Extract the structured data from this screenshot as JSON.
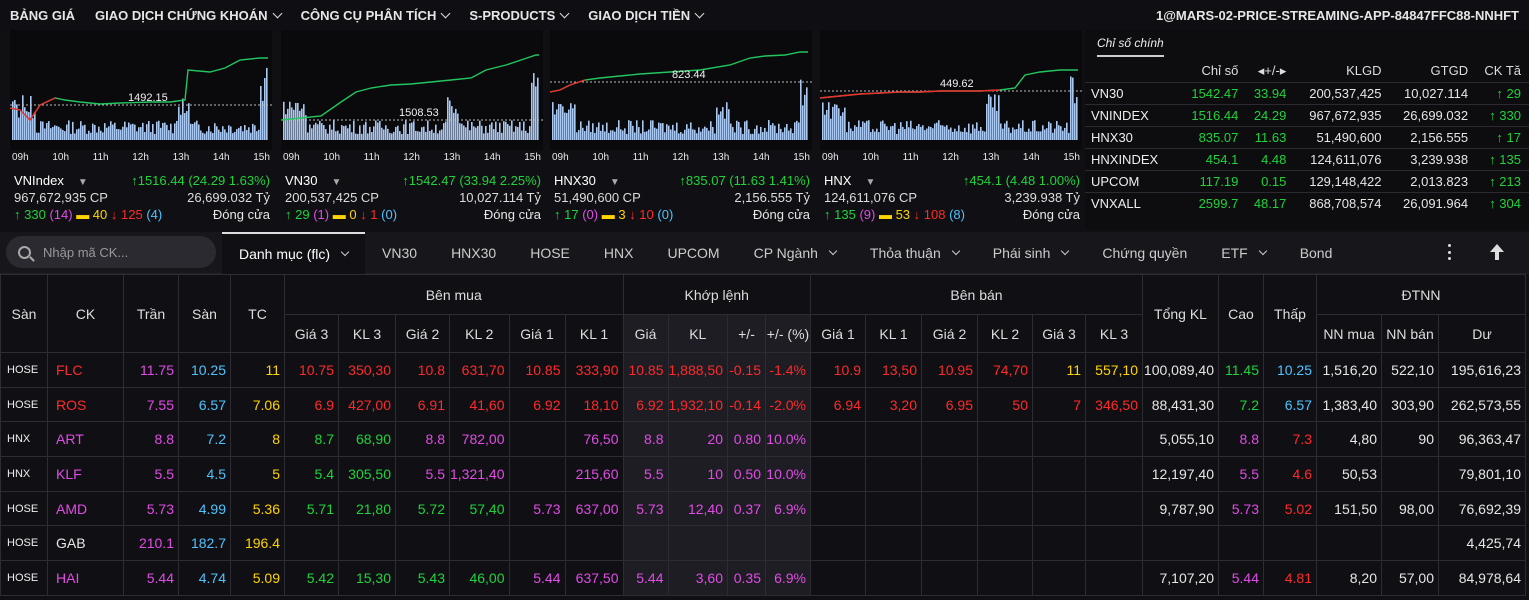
{
  "nav": {
    "items": [
      {
        "label": "BẢNG GIÁ",
        "dropdown": false
      },
      {
        "label": "GIAO DỊCH CHỨNG KHOÁN",
        "dropdown": true
      },
      {
        "label": "CÔNG CỤ PHÂN TÍCH",
        "dropdown": true
      },
      {
        "label": "S-PRODUCTS",
        "dropdown": true
      },
      {
        "label": "GIAO DỊCH TIỀN",
        "dropdown": true
      }
    ],
    "app_id": "1@MARS-02-PRICE-STREAMING-APP-84847FFC88-NNHFT"
  },
  "charts": [
    {
      "name": "VNIndex",
      "change": "↑1516.44 (24.29  1.63%)",
      "volume": "967,672,935 CP",
      "value": "26,699.032 Tỷ",
      "breadth": {
        "up": "↑ 330",
        "ceil": "(14)",
        "ref": "▬ 40",
        "down": "↓ 125",
        "floor": "(4)"
      },
      "status": "Đóng cửa",
      "ref_label": "1492.15",
      "times": [
        "09h",
        "10h",
        "11h",
        "12h",
        "13h",
        "14h",
        "15h"
      ]
    },
    {
      "name": "VN30",
      "change": "↑1542.47 (33.94  2.25%)",
      "volume": "200,537,425 CP",
      "value": "10,027.114 Tỷ",
      "breadth": {
        "up": "↑ 29",
        "ceil": "(1)",
        "ref": "▬ 0",
        "down": "↓ 1",
        "floor": "(0)"
      },
      "status": "Đóng cửa",
      "ref_label": "1508.53",
      "times": [
        "09h",
        "10h",
        "11h",
        "12h",
        "13h",
        "14h",
        "15h"
      ]
    },
    {
      "name": "HNX30",
      "change": "↑835.07 (11.63  1.41%)",
      "volume": "51,490,600 CP",
      "value": "2,156.555 Tỷ",
      "breadth": {
        "up": "↑ 17",
        "ceil": "(0)",
        "ref": "▬ 3",
        "down": "↓ 10",
        "floor": "(0)"
      },
      "status": "Đóng cửa",
      "ref_label": "823.44",
      "times": [
        "09h",
        "10h",
        "11h",
        "12h",
        "13h",
        "14h",
        "15h"
      ]
    },
    {
      "name": "HNX",
      "change": "↑454.1 (4.48  1.00%)",
      "volume": "124,611,076 CP",
      "value": "3,239.938 Tỷ",
      "breadth": {
        "up": "↑ 135",
        "ceil": "(9)",
        "ref": "▬ 53",
        "down": "↓ 108",
        "floor": "(8)"
      },
      "status": "Đóng cửa",
      "ref_label": "449.62",
      "times": [
        "09h",
        "10h",
        "11h",
        "12h",
        "13h",
        "14h",
        "15h"
      ]
    }
  ],
  "indices": {
    "tab": "Chỉ số chính",
    "headers": [
      "",
      "Chỉ số",
      "◂+/-▸",
      "KLGD",
      "GTGD",
      "CK Tă"
    ],
    "rows": [
      {
        "name": "VN30",
        "index": "1542.47",
        "change": "33.94",
        "volume": "200,537,425",
        "value": "10,027.114",
        "adv": "↑ 29"
      },
      {
        "name": "VNINDEX",
        "index": "1516.44",
        "change": "24.29",
        "volume": "967,672,935",
        "value": "26,699.032",
        "adv": "↑ 330"
      },
      {
        "name": "HNX30",
        "index": "835.07",
        "change": "11.63",
        "volume": "51,490,600",
        "value": "2,156.555",
        "adv": "↑ 17"
      },
      {
        "name": "HNXINDEX",
        "index": "454.1",
        "change": "4.48",
        "volume": "124,611,076",
        "value": "3,239.938",
        "adv": "↑ 135"
      },
      {
        "name": "UPCOM",
        "index": "117.19",
        "change": "0.15",
        "volume": "129,148,422",
        "value": "2,013.823",
        "adv": "↑ 213"
      },
      {
        "name": "VNXALL",
        "index": "2599.7",
        "change": "48.17",
        "volume": "868,708,574",
        "value": "26,091.964",
        "adv": "↑ 304"
      }
    ]
  },
  "toolbar": {
    "search_placeholder": "Nhập mã CK...",
    "tabs": [
      {
        "label": "Danh mục (flc)",
        "dropdown": true,
        "active": true
      },
      {
        "label": "VN30",
        "dropdown": false
      },
      {
        "label": "HNX30",
        "dropdown": false
      },
      {
        "label": "HOSE",
        "dropdown": false
      },
      {
        "label": "HNX",
        "dropdown": false
      },
      {
        "label": "UPCOM",
        "dropdown": false
      },
      {
        "label": "CP Ngành",
        "dropdown": true
      },
      {
        "label": "Thỏa thuận",
        "dropdown": true
      },
      {
        "label": "Phái sinh",
        "dropdown": true
      },
      {
        "label": "Chứng quyền",
        "dropdown": false
      },
      {
        "label": "ETF",
        "dropdown": true
      },
      {
        "label": "Bond",
        "dropdown": false
      }
    ]
  },
  "board": {
    "headers": {
      "san": "Sàn",
      "ck": "CK",
      "tran": "Trần",
      "san_floor": "Sàn",
      "tc": "TC",
      "ben_mua": "Bên mua",
      "khop_lenh": "Khớp lệnh",
      "ben_ban": "Bên bán",
      "tong_kl": "Tổng KL",
      "cao": "Cao",
      "thap": "Thấp",
      "dtnn": "ĐTNN",
      "gia3": "Giá 3",
      "kl3": "KL 3",
      "gia2": "Giá 2",
      "kl2": "KL 2",
      "gia1": "Giá 1",
      "kl1": "KL 1",
      "gia": "Giá",
      "kl": "KL",
      "pm": "+/-",
      "pmpct": "+/- (%)",
      "s_gia1": "Giá 1",
      "s_kl1": "KL 1",
      "s_gia2": "Giá 2",
      "s_kl2": "KL 2",
      "s_gia3": "Giá 3",
      "s_kl3": "KL 3",
      "nn_mua": "NN mua",
      "nn_ban": "NN bán",
      "du": "Dư"
    },
    "rows": [
      {
        "exch": "HOSE",
        "sym": "FLC",
        "symc": "dn",
        "tran": "11.75",
        "san": "10.25",
        "tc": "11",
        "b3": [
          "10.75",
          "dn"
        ],
        "bk3": [
          "350,30",
          "dn"
        ],
        "b2": [
          "10.8",
          "dn"
        ],
        "bk2": [
          "631,70",
          "dn"
        ],
        "b1": [
          "10.85",
          "dn"
        ],
        "bk1": [
          "333,90",
          "dn"
        ],
        "m": [
          "10.85",
          "dn"
        ],
        "mk": [
          "1,888,50",
          "dn"
        ],
        "pm": [
          "-0.15",
          "dn"
        ],
        "pp": [
          "-1.4%",
          "dn"
        ],
        "s1": [
          "10.9",
          "dn"
        ],
        "sk1": [
          "13,50",
          "dn"
        ],
        "s2": [
          "10.95",
          "dn"
        ],
        "sk2": [
          "74,70",
          "dn"
        ],
        "s3": [
          "11",
          "ref"
        ],
        "sk3": [
          "557,10",
          "ref"
        ],
        "tkl": "100,089,40",
        "cao": [
          "11.45",
          "up"
        ],
        "thap": [
          "10.25",
          "fl"
        ],
        "nnm": "1,516,20",
        "nnb": "522,10",
        "du": "195,616,23"
      },
      {
        "exch": "HOSE",
        "sym": "ROS",
        "symc": "dn",
        "tran": "7.55",
        "san": "6.57",
        "tc": "7.06",
        "b3": [
          "6.9",
          "dn"
        ],
        "bk3": [
          "427,00",
          "dn"
        ],
        "b2": [
          "6.91",
          "dn"
        ],
        "bk2": [
          "41,60",
          "dn"
        ],
        "b1": [
          "6.92",
          "dn"
        ],
        "bk1": [
          "18,10",
          "dn"
        ],
        "m": [
          "6.92",
          "dn"
        ],
        "mk": [
          "1,932,10",
          "dn"
        ],
        "pm": [
          "-0.14",
          "dn"
        ],
        "pp": [
          "-2.0%",
          "dn"
        ],
        "s1": [
          "6.94",
          "dn"
        ],
        "sk1": [
          "3,20",
          "dn"
        ],
        "s2": [
          "6.95",
          "dn"
        ],
        "sk2": [
          "50",
          "dn"
        ],
        "s3": [
          "7",
          "dn"
        ],
        "sk3": [
          "346,50",
          "dn"
        ],
        "tkl": "88,431,30",
        "cao": [
          "7.2",
          "up"
        ],
        "thap": [
          "6.57",
          "fl"
        ],
        "nnm": "1,383,40",
        "nnb": "303,90",
        "du": "262,573,55"
      },
      {
        "exch": "HNX",
        "sym": "ART",
        "symc": "ce",
        "tran": "8.8",
        "san": "7.2",
        "tc": "8",
        "b3": [
          "8.7",
          "up"
        ],
        "bk3": [
          "68,90",
          "up"
        ],
        "b2": [
          "8.8",
          "ce"
        ],
        "bk2": [
          "782,00",
          "ce"
        ],
        "b1": [
          "",
          ""
        ],
        "bk1": [
          "76,50",
          "ce"
        ],
        "m": [
          "8.8",
          "ce"
        ],
        "mk": [
          "20",
          "ce"
        ],
        "pm": [
          "0.80",
          "ce"
        ],
        "pp": [
          "10.0%",
          "ce"
        ],
        "s1": [
          "",
          ""
        ],
        "sk1": [
          "",
          ""
        ],
        "s2": [
          "",
          ""
        ],
        "sk2": [
          "",
          ""
        ],
        "s3": [
          "",
          ""
        ],
        "sk3": [
          "",
          ""
        ],
        "tkl": "5,055,10",
        "cao": [
          "8.8",
          "ce"
        ],
        "thap": [
          "7.3",
          "dn"
        ],
        "nnm": "4,80",
        "nnb": "90",
        "du": "96,363,47"
      },
      {
        "exch": "HNX",
        "sym": "KLF",
        "symc": "ce",
        "tran": "5.5",
        "san": "4.5",
        "tc": "5",
        "b3": [
          "5.4",
          "up"
        ],
        "bk3": [
          "305,50",
          "up"
        ],
        "b2": [
          "5.5",
          "ce"
        ],
        "bk2": [
          "1,321,40",
          "ce"
        ],
        "b1": [
          "",
          ""
        ],
        "bk1": [
          "215,60",
          "ce"
        ],
        "m": [
          "5.5",
          "ce"
        ],
        "mk": [
          "10",
          "ce"
        ],
        "pm": [
          "0.50",
          "ce"
        ],
        "pp": [
          "10.0%",
          "ce"
        ],
        "s1": [
          "",
          ""
        ],
        "sk1": [
          "",
          ""
        ],
        "s2": [
          "",
          ""
        ],
        "sk2": [
          "",
          ""
        ],
        "s3": [
          "",
          ""
        ],
        "sk3": [
          "",
          ""
        ],
        "tkl": "12,197,40",
        "cao": [
          "5.5",
          "ce"
        ],
        "thap": [
          "4.6",
          "dn"
        ],
        "nnm": "50,53",
        "nnb": "",
        "du": "79,801,10"
      },
      {
        "exch": "HOSE",
        "sym": "AMD",
        "symc": "ce",
        "tran": "5.73",
        "san": "4.99",
        "tc": "5.36",
        "b3": [
          "5.71",
          "up"
        ],
        "bk3": [
          "21,80",
          "up"
        ],
        "b2": [
          "5.72",
          "up"
        ],
        "bk2": [
          "57,40",
          "up"
        ],
        "b1": [
          "5.73",
          "ce"
        ],
        "bk1": [
          "637,00",
          "ce"
        ],
        "m": [
          "5.73",
          "ce"
        ],
        "mk": [
          "12,40",
          "ce"
        ],
        "pm": [
          "0.37",
          "ce"
        ],
        "pp": [
          "6.9%",
          "ce"
        ],
        "s1": [
          "",
          ""
        ],
        "sk1": [
          "",
          ""
        ],
        "s2": [
          "",
          ""
        ],
        "sk2": [
          "",
          ""
        ],
        "s3": [
          "",
          ""
        ],
        "sk3": [
          "",
          ""
        ],
        "tkl": "9,787,90",
        "cao": [
          "5.73",
          "ce"
        ],
        "thap": [
          "5.02",
          "dn"
        ],
        "nnm": "151,50",
        "nnb": "98,00",
        "du": "76,692,39"
      },
      {
        "exch": "HOSE",
        "sym": "GAB",
        "symc": "white",
        "tran": "210.1",
        "san": "182.7",
        "tc": "196.4",
        "b3": [
          "",
          ""
        ],
        "bk3": [
          "",
          ""
        ],
        "b2": [
          "",
          ""
        ],
        "bk2": [
          "",
          ""
        ],
        "b1": [
          "",
          ""
        ],
        "bk1": [
          "",
          ""
        ],
        "m": [
          "",
          ""
        ],
        "mk": [
          "",
          ""
        ],
        "pm": [
          "",
          ""
        ],
        "pp": [
          "",
          ""
        ],
        "s1": [
          "",
          ""
        ],
        "sk1": [
          "",
          ""
        ],
        "s2": [
          "",
          ""
        ],
        "sk2": [
          "",
          ""
        ],
        "s3": [
          "",
          ""
        ],
        "sk3": [
          "",
          ""
        ],
        "tkl": "",
        "cao": [
          "",
          ""
        ],
        "thap": [
          "",
          ""
        ],
        "nnm": "",
        "nnb": "",
        "du": "4,425,74"
      },
      {
        "exch": "HOSE",
        "sym": "HAI",
        "symc": "ce",
        "tran": "5.44",
        "san": "4.74",
        "tc": "5.09",
        "b3": [
          "5.42",
          "up"
        ],
        "bk3": [
          "15,30",
          "up"
        ],
        "b2": [
          "5.43",
          "up"
        ],
        "bk2": [
          "46,00",
          "up"
        ],
        "b1": [
          "5.44",
          "ce"
        ],
        "bk1": [
          "637,50",
          "ce"
        ],
        "m": [
          "5.44",
          "ce"
        ],
        "mk": [
          "3,60",
          "ce"
        ],
        "pm": [
          "0.35",
          "ce"
        ],
        "pp": [
          "6.9%",
          "ce"
        ],
        "s1": [
          "",
          ""
        ],
        "sk1": [
          "",
          ""
        ],
        "s2": [
          "",
          ""
        ],
        "sk2": [
          "",
          ""
        ],
        "s3": [
          "",
          ""
        ],
        "sk3": [
          "",
          ""
        ],
        "tkl": "7,107,20",
        "cao": [
          "5.44",
          "ce"
        ],
        "thap": [
          "4.81",
          "dn"
        ],
        "nnm": "8,20",
        "nnb": "57,00",
        "du": "84,978,64"
      }
    ]
  }
}
